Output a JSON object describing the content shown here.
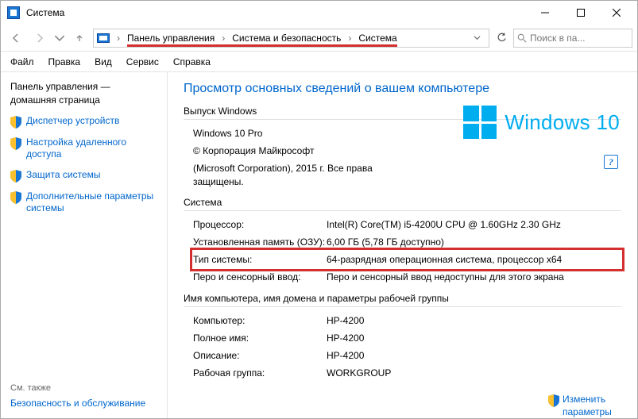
{
  "window": {
    "title": "Система",
    "min_label": "Свернуть",
    "max_label": "Развернуть",
    "close_label": "Закрыть"
  },
  "breadcrumbs": {
    "item1": "Панель управления",
    "item2": "Система и безопасность",
    "item3": "Система"
  },
  "search": {
    "placeholder": "Поиск в па..."
  },
  "menu": {
    "file": "Файл",
    "edit": "Правка",
    "view": "Вид",
    "tools": "Сервис",
    "help": "Справка"
  },
  "sidebar": {
    "home": "Панель управления — домашняя страница",
    "devmgr": "Диспетчер устройств",
    "remote": "Настройка удаленного доступа",
    "protect": "Защита системы",
    "advanced": "Дополнительные параметры системы",
    "see_also": "См. также",
    "security": "Безопасность и обслуживание"
  },
  "main": {
    "heading": "Просмотр основных сведений о вашем компьютере",
    "edition_section": "Выпуск Windows",
    "edition": "Windows 10 Pro",
    "copyright1": "© Корпорация Майкрософт",
    "copyright2": "(Microsoft Corporation), 2015 г. Все права защищены.",
    "win_brand": "Windows 10",
    "system_section": "Система",
    "proc_k": "Процессор:",
    "proc_v": "Intel(R) Core(TM) i5-4200U CPU @ 1.60GHz   2.30 GHz",
    "ram_k": "Установленная память (ОЗУ):",
    "ram_v": "6,00 ГБ (5,78 ГБ доступно)",
    "type_k": "Тип системы:",
    "type_v": "64-разрядная операционная система, процессор x64",
    "pen_k": "Перо и сенсорный ввод:",
    "pen_v": "Перо и сенсорный ввод недоступны для этого экрана",
    "domain_section": "Имя компьютера, имя домена и параметры рабочей группы",
    "cname_k": "Компьютер:",
    "cname_v": "HP-4200",
    "fname_k": "Полное имя:",
    "fname_v": "HP-4200",
    "desc_k": "Описание:",
    "desc_v": "HP-4200",
    "wg_k": "Рабочая группа:",
    "wg_v": "WORKGROUP",
    "change_link": "Изменить параметры"
  }
}
